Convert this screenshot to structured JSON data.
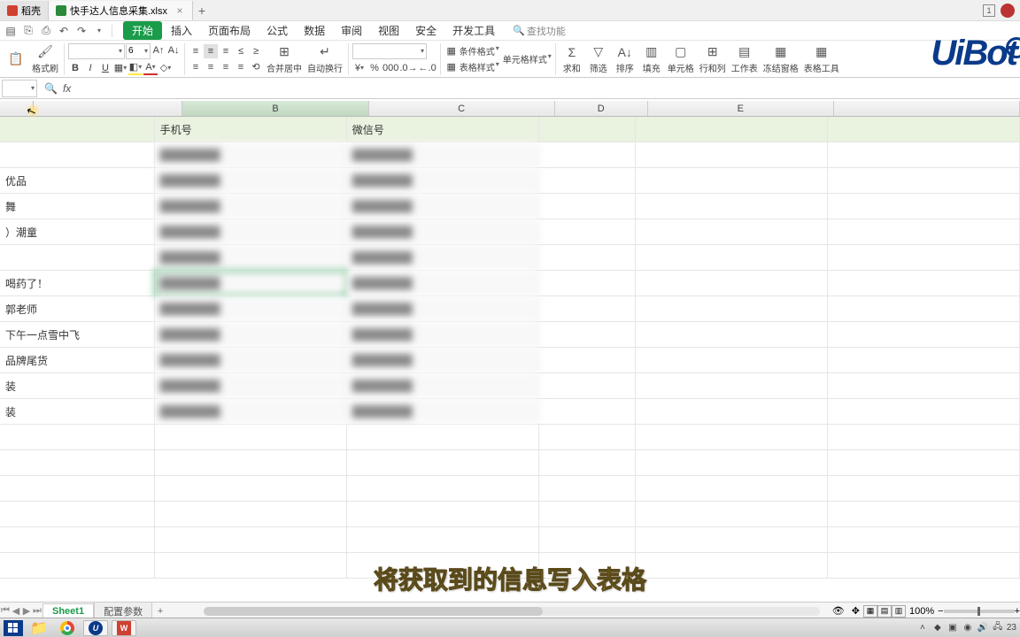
{
  "tabs": {
    "first": "稻壳",
    "second": "快手达人信息采集.xlsx"
  },
  "menu": [
    "开始",
    "插入",
    "页面布局",
    "公式",
    "数据",
    "审阅",
    "视图",
    "安全",
    "开发工具"
  ],
  "search_placeholder": "查找功能",
  "font_size": "6",
  "ribbon_labels": {
    "format_painter": "格式刷",
    "merge": "合并居中",
    "wrap": "自动换行",
    "cond": "条件格式",
    "cell_style": "单元格样式",
    "table_style": "表格样式",
    "sum": "求和",
    "filter": "筛选",
    "sort": "排序",
    "fill": "填充",
    "cell": "单元格",
    "rowcol": "行和列",
    "sheet": "工作表",
    "freeze": "冻结窗格",
    "table_tool": "表格工具"
  },
  "columns": [
    "B",
    "C",
    "D",
    "E"
  ],
  "headers": {
    "col_a_visible": "",
    "col_b": "手机号",
    "col_c": "微信号"
  },
  "rows_a": [
    "",
    "优品",
    "舞",
    "）潮童",
    "",
    "喝药了！",
    "郭老师",
    "下午一点雪中飞",
    "品牌尾货",
    "装",
    "装",
    "",
    "",
    ""
  ],
  "sheet_tabs": {
    "active": "Sheet1",
    "other": "配置参数"
  },
  "caption": "将获取到的信息写入表格",
  "zoom": "100%",
  "clock": "23"
}
